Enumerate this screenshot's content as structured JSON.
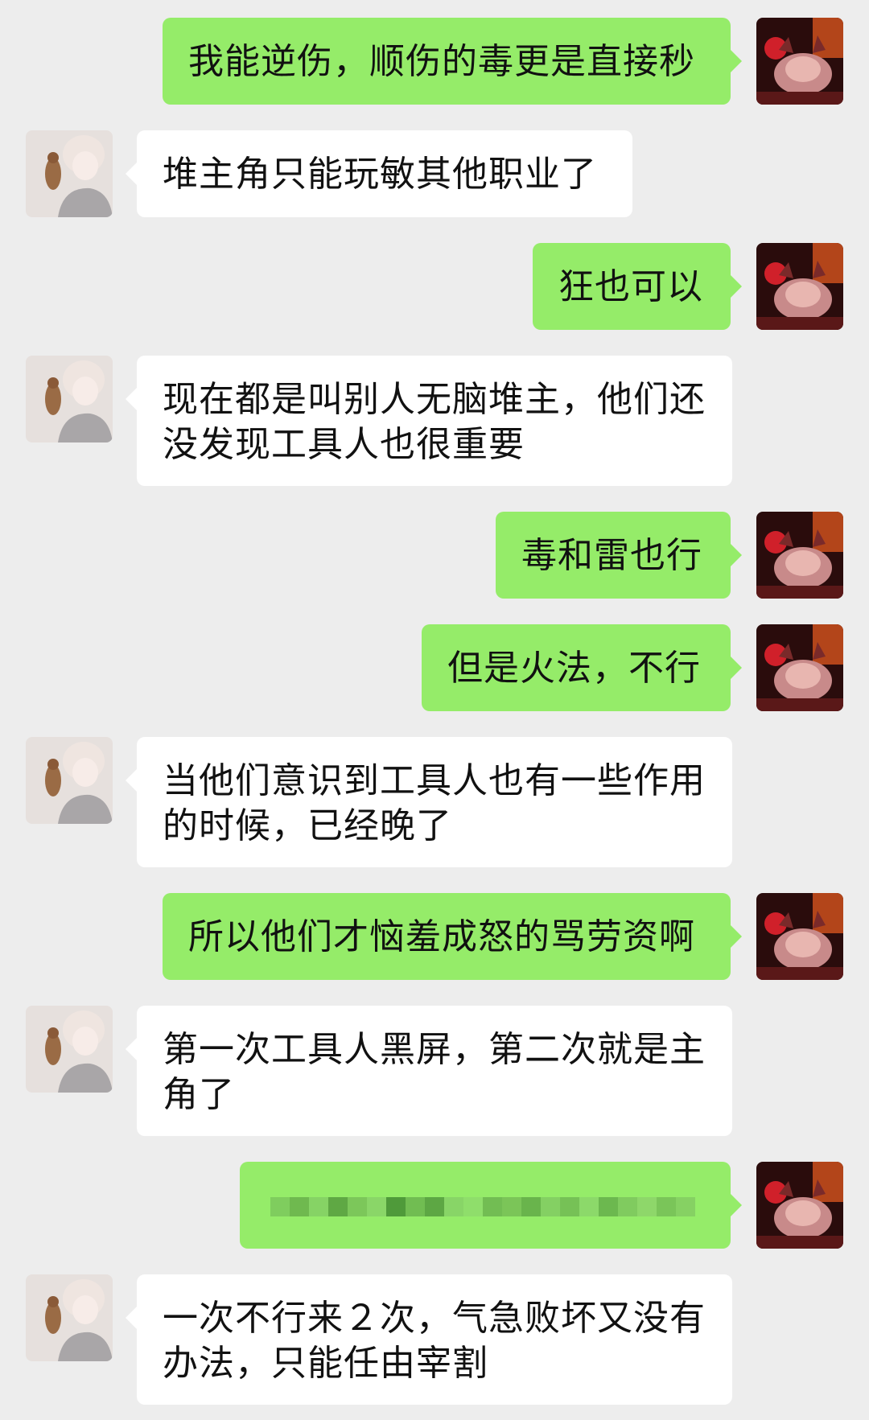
{
  "colors": {
    "background": "#ededed",
    "sent_bubble": "#95ec69",
    "received_bubble": "#ffffff"
  },
  "avatars": {
    "self_icon": "cat-demon-avatar-icon",
    "peer_icon": "anime-boy-with-bird-avatar-icon"
  },
  "messages": [
    {
      "side": "sent",
      "text": "我能逆伤，顺伤的毒更是直接秒"
    },
    {
      "side": "recv",
      "text": "堆主角只能玩敏其他职业了"
    },
    {
      "side": "sent",
      "text": "狂也可以"
    },
    {
      "side": "recv",
      "text": "现在都是叫别人无脑堆主，他们还没发现工具人也很重要"
    },
    {
      "side": "sent",
      "text": "毒和雷也行"
    },
    {
      "side": "sent",
      "text": "但是火法，不行"
    },
    {
      "side": "recv",
      "text": "当他们意识到工具人也有一些作用的时候，已经晚了"
    },
    {
      "side": "sent",
      "text": "所以他们才恼羞成怒的骂劳资啊"
    },
    {
      "side": "recv",
      "text": "第一次工具人黑屏，第二次就是主角了"
    },
    {
      "side": "sent",
      "text": "",
      "blurred": true
    },
    {
      "side": "recv",
      "text": "一次不行来２次，气急败坏又没有办法，只能任由宰割"
    }
  ]
}
